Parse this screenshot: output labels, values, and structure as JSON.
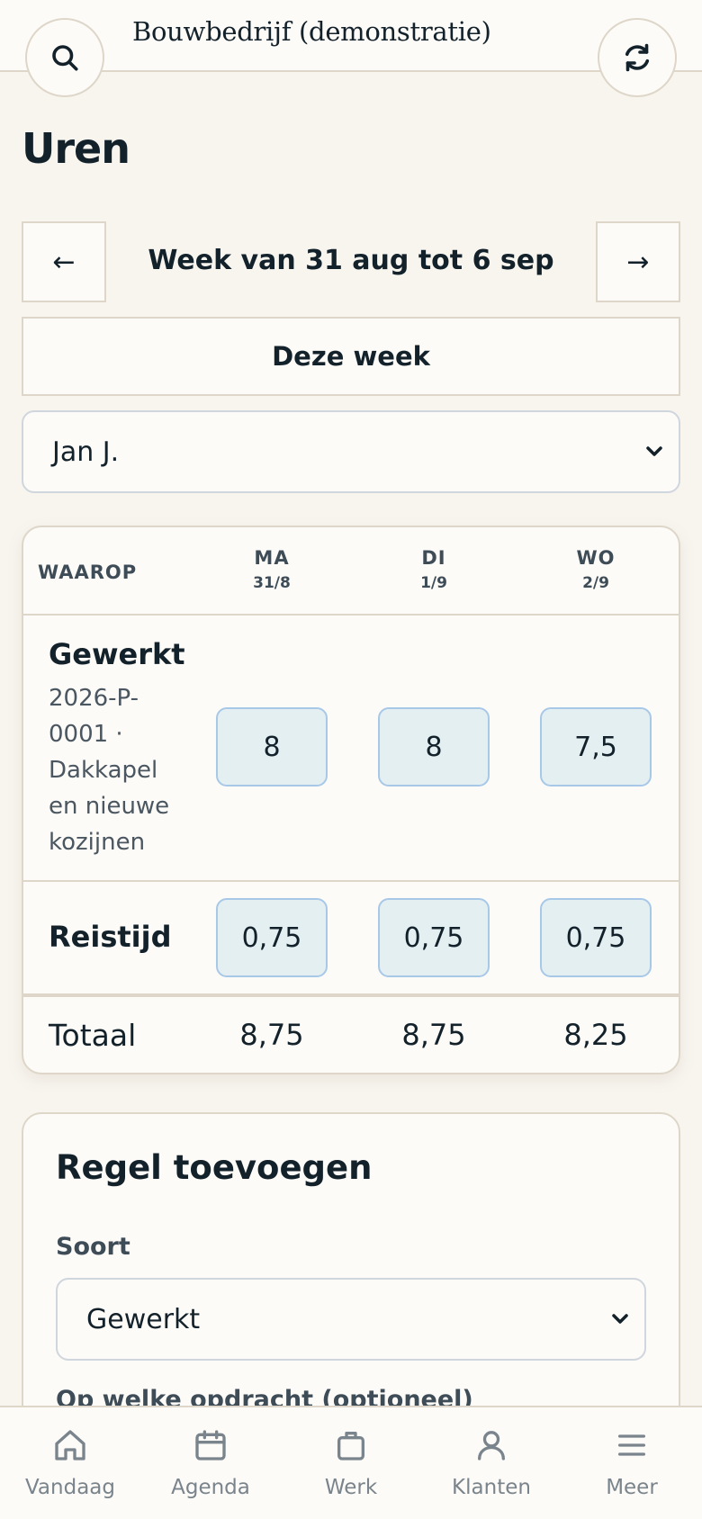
{
  "header": {
    "brand": "Bouwbedrijf (demonstratie)",
    "search_icon": "search-icon",
    "refresh_icon": "refresh-icon"
  },
  "page": {
    "title": "Uren"
  },
  "week_nav": {
    "prev_label": "←",
    "next_label": "→",
    "week_label": "Week van 31 aug tot 6 sep",
    "this_week_label": "Deze week"
  },
  "employee_select": {
    "value": "Jan J."
  },
  "hours_table": {
    "header_label": "WAAROP",
    "days": [
      {
        "day": "MA",
        "date": "31/8"
      },
      {
        "day": "DI",
        "date": "1/9"
      },
      {
        "day": "WO",
        "date": "2/9"
      }
    ],
    "rows": [
      {
        "title": "Gewerkt",
        "subtitle": "2026-P-0001 · Dakkapel en nieuwe kozijnen",
        "values": [
          "8",
          "8",
          "7,5"
        ]
      },
      {
        "title": "Reistijd",
        "subtitle": "",
        "values": [
          "0,75",
          "0,75",
          "0,75"
        ]
      }
    ],
    "total_label": "Totaal",
    "totals": [
      "8,75",
      "8,75",
      "8,25"
    ]
  },
  "add_line": {
    "title": "Regel toevoegen",
    "type_label": "Soort",
    "type_value": "Gewerkt",
    "assignment_label": "Op welke opdracht (optioneel)"
  },
  "bottom_nav": [
    {
      "label": "Vandaag",
      "icon": "home-icon"
    },
    {
      "label": "Agenda",
      "icon": "calendar-icon"
    },
    {
      "label": "Werk",
      "icon": "briefcase-icon"
    },
    {
      "label": "Klanten",
      "icon": "user-icon"
    },
    {
      "label": "Meer",
      "icon": "menu-icon"
    }
  ],
  "colors": {
    "background": "#f8f5ef",
    "surface": "#fdfbf7",
    "border": "#ddd6c9",
    "text": "#13212b",
    "input_fill": "#e4eff2",
    "input_border": "#a8c8e8",
    "nav_text": "#7a848c"
  }
}
